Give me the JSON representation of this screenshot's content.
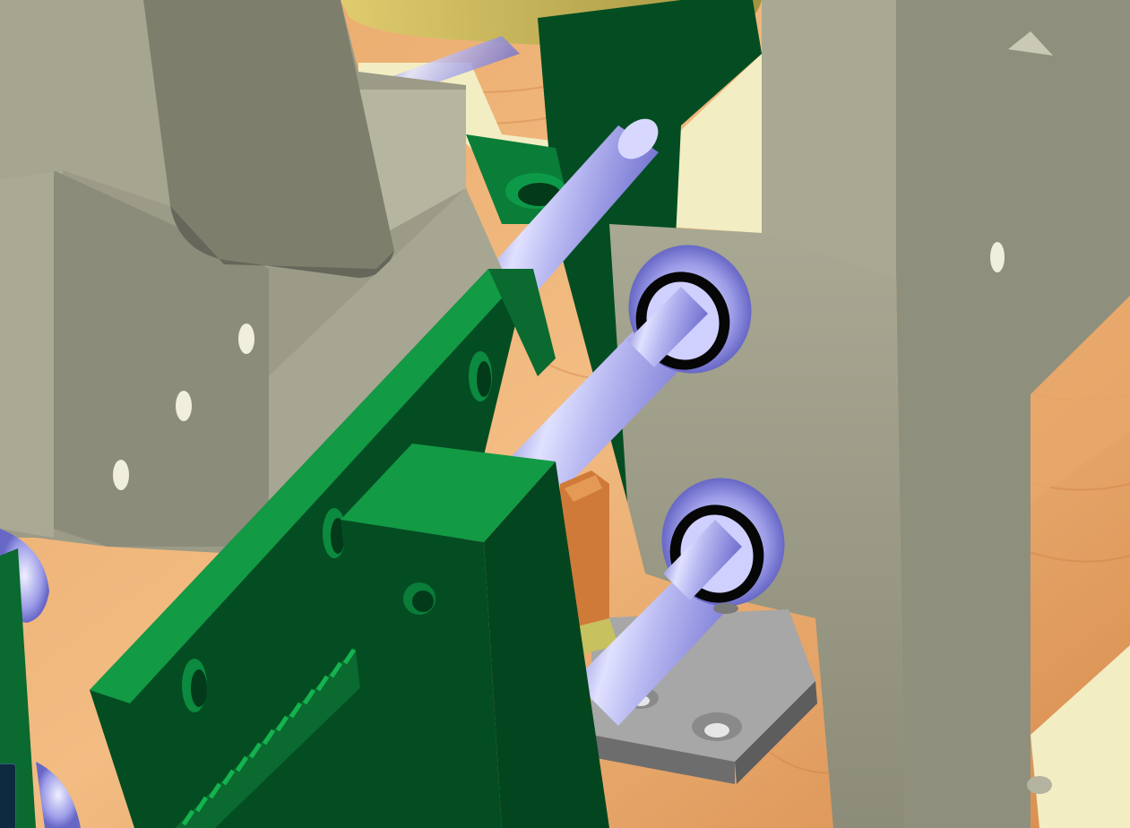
{
  "scene": {
    "kind": "3d-cad-viewport",
    "parts": [
      "bracket-left",
      "bracket-right",
      "rod-upper",
      "rod-middle",
      "rod-lower",
      "bearing-middle",
      "bearing-lower",
      "rail-green",
      "block-green",
      "gear-rack",
      "mount-plate",
      "pinion-gear",
      "wood-table"
    ],
    "colors": {
      "wood_light": "#e9a86a",
      "wood_dark": "#c9783e",
      "cream": "#f3edc3",
      "gray_light": "#b6b6a0",
      "gray_mid": "#9b9b87",
      "gray_dark": "#7e7e6c",
      "green_light": "#139a45",
      "green_dark": "#044d22",
      "rod_light": "#e0e1ff",
      "rod_mid": "#8f8fe6",
      "rod_dark": "#5a5ac0",
      "plate_light": "#a7a7a7",
      "plate_dark": "#7b7b7b",
      "copper": "#d07a3a",
      "translucent_yellow": "#c7c160"
    }
  },
  "widgets": {
    "corner_widget_icon": "view-cube-icon"
  }
}
